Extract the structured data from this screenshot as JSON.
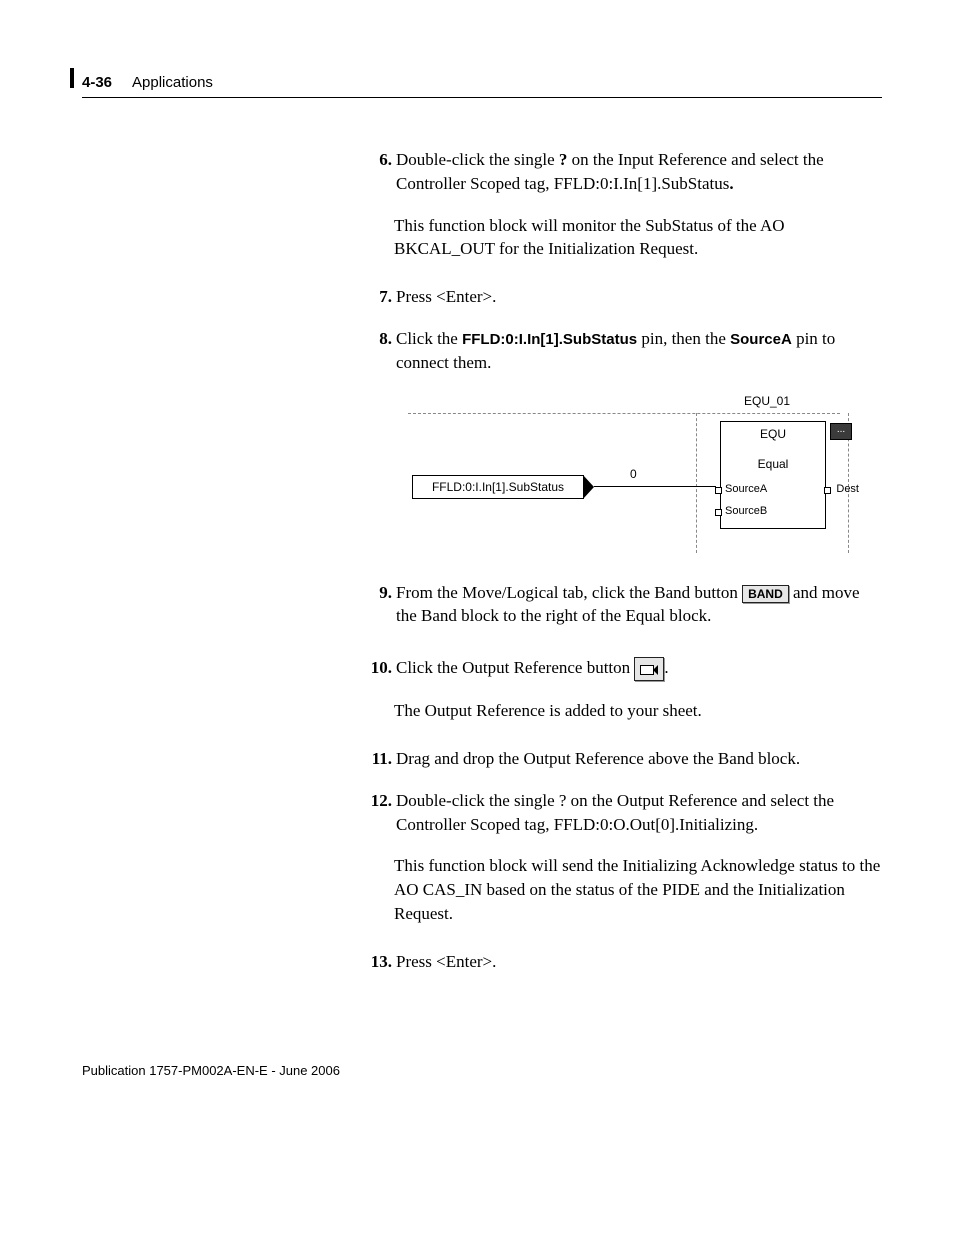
{
  "header": {
    "page_number": "4-36",
    "section": "Applications"
  },
  "steps": {
    "s6": {
      "num": "6.",
      "text_a": "Double-click the single ",
      "text_b": "?",
      "text_c": " on the Input Reference and select the Controller Scoped tag, FFLD:0:I.In[1].SubStatus",
      "text_d": ".",
      "note": "This function block will monitor the SubStatus of the AO BKCAL_OUT for the Initialization Request."
    },
    "s7": {
      "num": "7.",
      "text": "Press <Enter>."
    },
    "s8": {
      "num": "8.",
      "text_a": "Click the ",
      "text_pin": "FFLD:0:I.In[1].SubStatus",
      "text_b": " pin, then the ",
      "text_source": "SourceA",
      "text_c": " pin to connect them."
    },
    "s9": {
      "num": "9.",
      "text_a": "From the Move/Logical tab, click the Band button ",
      "band_btn": "BAND",
      "text_b": " and move the Band block to the right of the Equal block."
    },
    "s10": {
      "num": "10.",
      "text_a": "Click the Output Reference button ",
      "text_b": ".",
      "note": "The Output Reference is added to your sheet."
    },
    "s11": {
      "num": "11.",
      "text": "Drag and drop the Output Reference above the Band block."
    },
    "s12": {
      "num": "12.",
      "text": "Double-click the single ? on the Output Reference and select the Controller Scoped tag, FFLD:0:O.Out[0].Initializing.",
      "note": "This function block will send the Initializing Acknowledge status to the AO CAS_IN based on the status of the PIDE and the Initialization Request."
    },
    "s13": {
      "num": "13.",
      "text": "Press <Enter>."
    }
  },
  "diagram": {
    "block_label": "EQU_01",
    "block_title": "EQU",
    "block_sub": "Equal",
    "source_a": "SourceA",
    "source_b": "SourceB",
    "dest": "Dest",
    "zero": "0",
    "input_ref": "FFLD:0:I.In[1].SubStatus",
    "ellipsis": "..."
  },
  "footer": "Publication 1757-PM002A-EN-E - June 2006"
}
